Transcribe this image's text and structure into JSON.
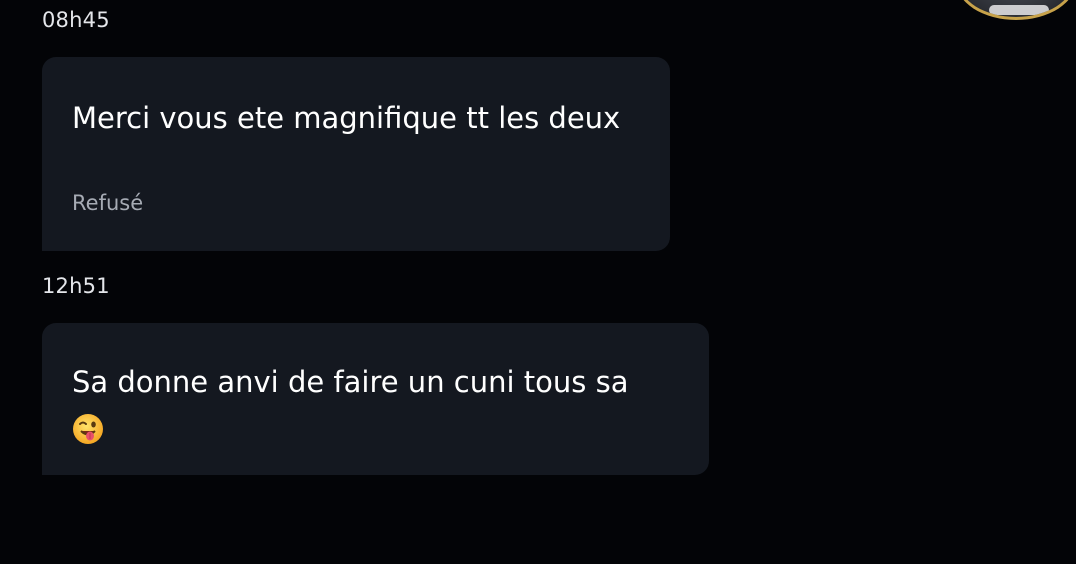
{
  "conversation": {
    "messages": [
      {
        "time": "08h45",
        "text": "Merci vous ete magnifique tt les deux",
        "status": "Refusé"
      },
      {
        "time": "12h51",
        "text": "Sa donne anvi de faire un cuni tous sa",
        "emoji": "winking-face-with-tongue-icon"
      }
    ]
  },
  "colors": {
    "background": "#030407",
    "bubble": "#141820",
    "text": "#ffffff",
    "muted": "#a6abb4"
  }
}
